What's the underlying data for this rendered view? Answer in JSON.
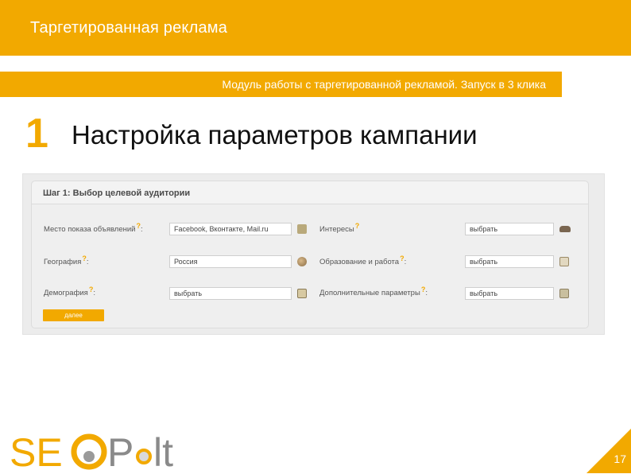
{
  "header": {
    "title": "Таргетированная реклама",
    "subtitle": "Модуль работы с таргетированной рекламой. Запуск в 3 клика"
  },
  "step": {
    "number": "1",
    "title": "Настройка параметров кампании"
  },
  "form": {
    "title": "Шаг 1: Выбор целевой аудитории",
    "help_mark": "?",
    "left_rows": [
      {
        "label": "Место показа объявлений",
        "value": "Facebook, Вконтакте, Mail.ru",
        "icon": "facebook-icon"
      },
      {
        "label": "География",
        "value": "Россия",
        "icon": "globe-icon"
      },
      {
        "label": "Демография",
        "value": "выбрать",
        "icon": "box-icon"
      }
    ],
    "right_rows": [
      {
        "label": "Интересы",
        "value": "выбрать",
        "icon": "car-icon"
      },
      {
        "label": "Образование и работа",
        "value": "выбрать",
        "icon": "id-card-icon"
      },
      {
        "label": "Дополнительные параметры",
        "value": "выбрать",
        "icon": "chart-icon"
      }
    ],
    "next_label": "далее"
  },
  "logo": {
    "text": "SEOPult"
  },
  "page_number": "17",
  "colors": {
    "accent": "#f2a900",
    "logo_gray": "#8a8a8a"
  }
}
